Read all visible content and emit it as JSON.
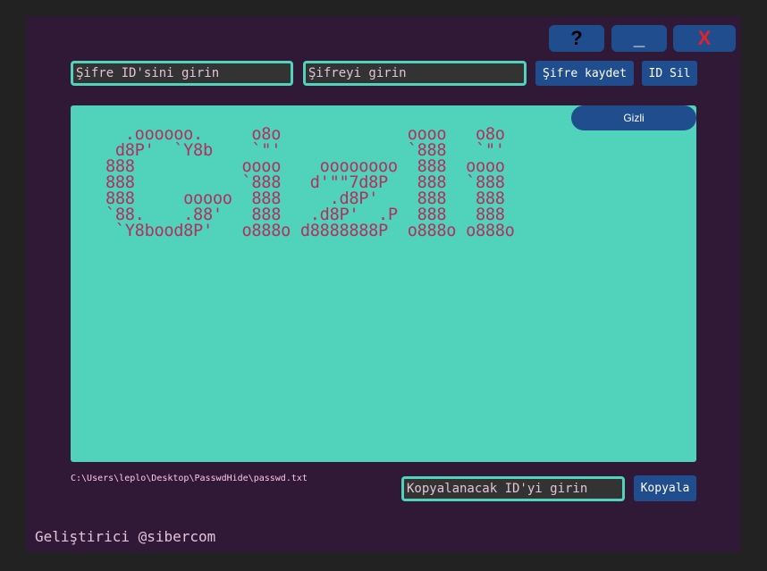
{
  "titlebar": {
    "help_label": "?",
    "minimize_label": "_",
    "close_label": "X"
  },
  "form": {
    "id_input_value": "Şifre ID'sini girin",
    "password_input_value": "Şifreyi girin",
    "save_label": "Şifre kaydet",
    "delete_label": "ID Sil"
  },
  "display": {
    "ascii_art": "  .oooooo.     o8o             oooo   o8o\n d8P'  `Y8b    `\"'             `888   `\"'\n888           oooo    oooooooo  888  oooo\n888           `888   d'\"\"7d8P   888  `888\n888     ooooo  888     .d8P'    888   888\n`88.    .88'   888   .d8P'  .P  888   888\n `Y8bood8P'   o888o d8888888P  o888o o888o",
    "toggle_label": "Gizli"
  },
  "footer": {
    "file_path": "C:\\Users\\leplo\\Desktop\\PasswdHide\\passwd.txt",
    "copy_input_value": "Kopyalanacak ID'yi girin",
    "copy_label": "Kopyala",
    "developer_credit": "Geliştirici @sibercom"
  },
  "colors": {
    "window_bg": "#2f1937",
    "accent": "#51d2bb",
    "button_bg": "#1f4d8d",
    "ascii_text": "#b0315d",
    "close_red": "#e8202a"
  }
}
